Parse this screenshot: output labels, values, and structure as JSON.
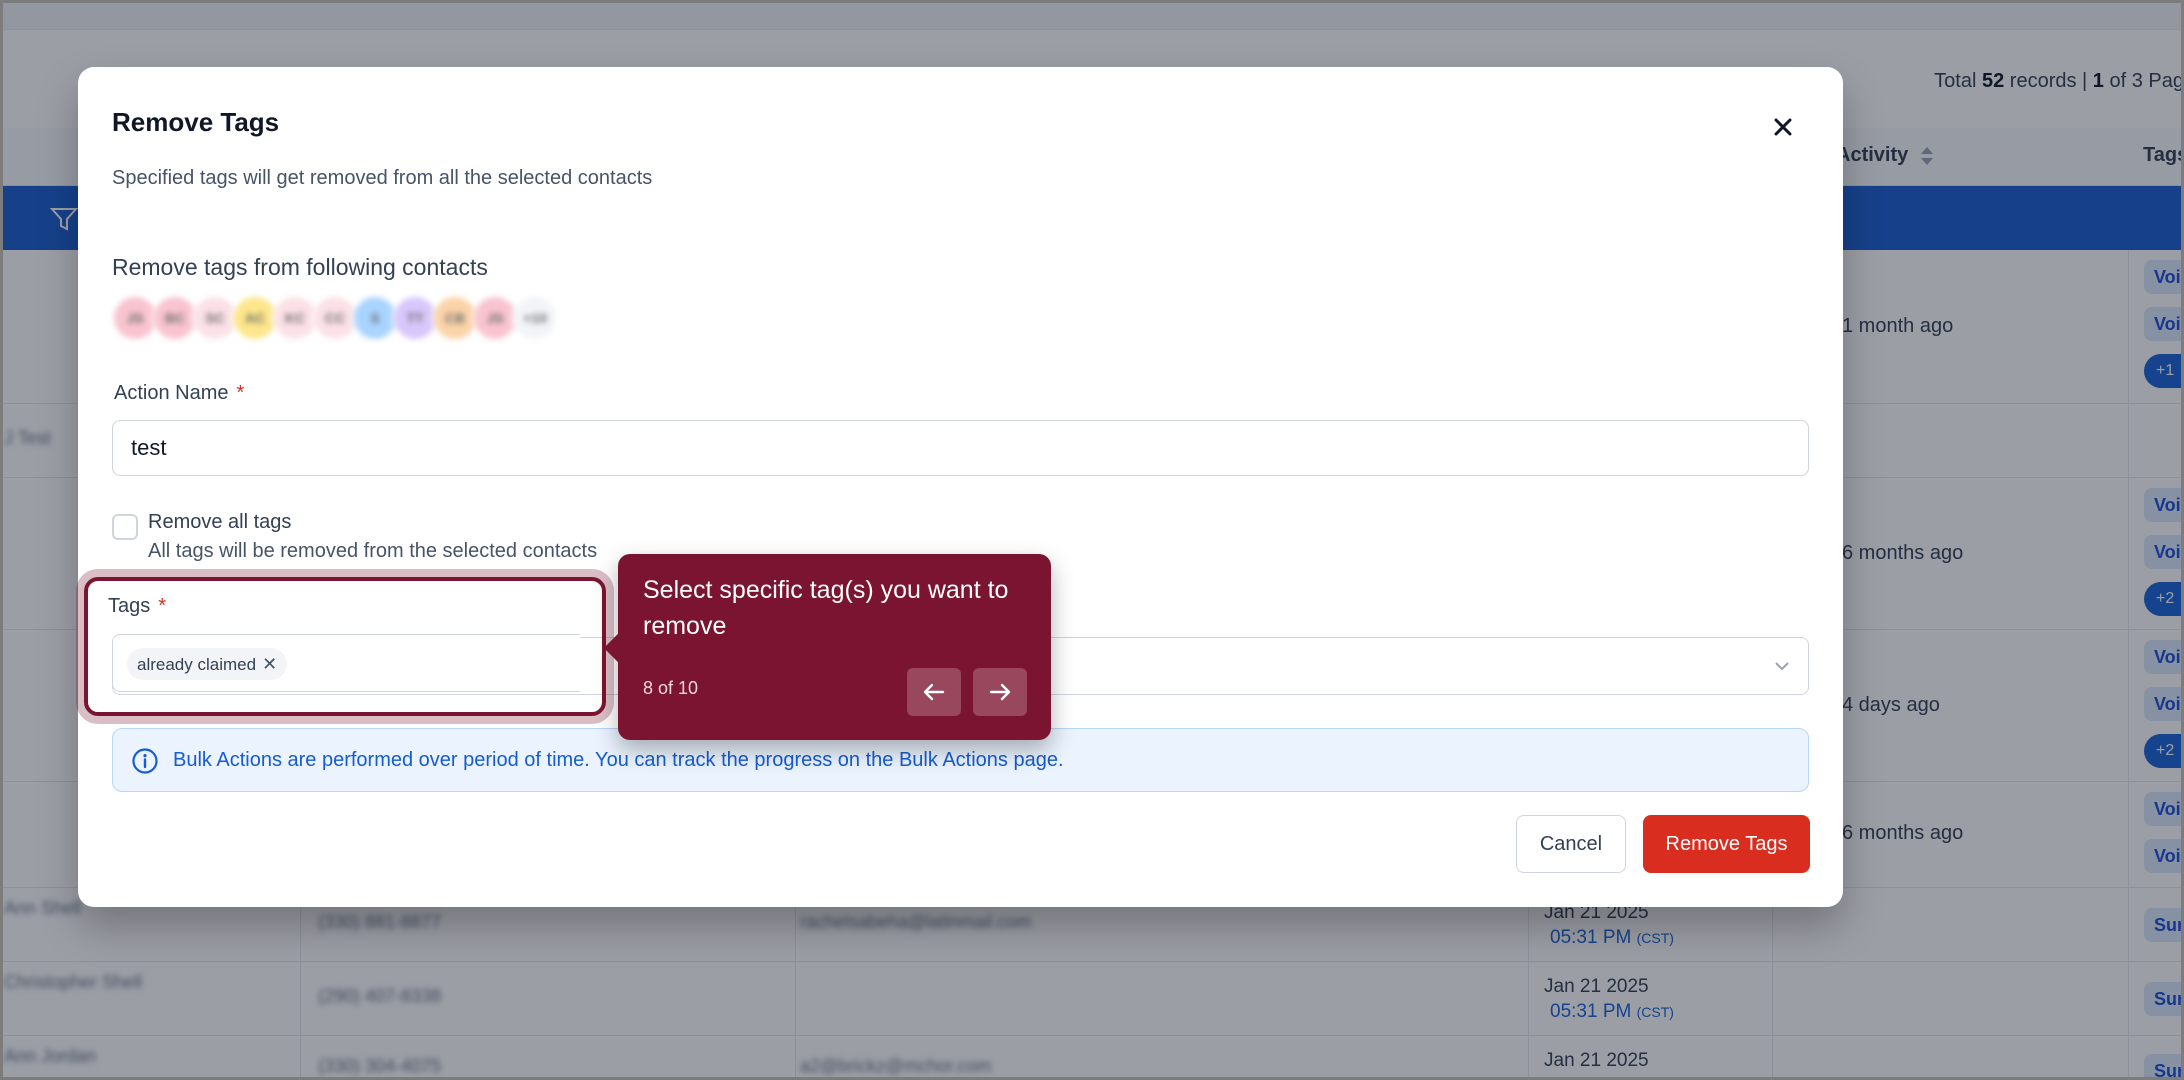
{
  "background": {
    "records": {
      "prefix": "Total",
      "count": "52",
      "mid": "records |",
      "page": "1",
      "suffix": "of 3 Pag"
    },
    "columns": {
      "activity": "Activity",
      "tags": "Tags"
    },
    "rows": [
      {
        "activity": "1 month ago",
        "tags": [
          "Voi",
          "Voi"
        ],
        "more": "+1"
      },
      {
        "activity": "",
        "tags": [],
        "more": ""
      },
      {
        "activity": "6 months ago",
        "tags": [
          "Voi",
          "Voi"
        ],
        "more": "+2"
      },
      {
        "activity": "4 days ago",
        "tags": [
          "Voi",
          "Voi"
        ],
        "more": "+2"
      },
      {
        "activity": "6 months ago",
        "tags": [
          "Voi",
          "Voi"
        ],
        "more": ""
      }
    ],
    "lower_rows": [
      {
        "date": "Jan 21 2025",
        "time": "05:31 PM",
        "tz": "(CST)",
        "tag": "Sur"
      },
      {
        "date": "Jan 21 2025",
        "time": "05:31 PM",
        "tz": "(CST)",
        "tag": "Sur"
      },
      {
        "date": "Jan 21 2025",
        "tag": "Sur"
      }
    ]
  },
  "modal": {
    "title": "Remove Tags",
    "subtitle": "Specified tags will get removed from all the selected contacts",
    "contacts_heading": "Remove tags from following contacts",
    "avatars": [
      {
        "initials": "JS",
        "color": "#f9c4cf"
      },
      {
        "initials": "BC",
        "color": "#f9c4cf"
      },
      {
        "initials": "SC",
        "color": "#fbe1e6"
      },
      {
        "initials": "AC",
        "color": "#fde68a"
      },
      {
        "initials": "KC",
        "color": "#fbe1e6"
      },
      {
        "initials": "CC",
        "color": "#fbe1e6"
      },
      {
        "initials": "S",
        "color": "#a9d4ff"
      },
      {
        "initials": "TT",
        "color": "#d7c7fb"
      },
      {
        "initials": "CB",
        "color": "#fbd3a8"
      },
      {
        "initials": "JS",
        "color": "#f9c4cf"
      },
      {
        "initials": "+10",
        "color": "#f2f4f7"
      }
    ],
    "action_name_label": "Action Name",
    "action_name_value": "test",
    "remove_all_label": "Remove all tags",
    "remove_all_desc": "All tags will be removed from the selected contacts",
    "tags_label": "Tags",
    "selected_tag": "already claimed",
    "info_text": "Bulk Actions are performed over period of time. You can track the progress on the Bulk Actions page.",
    "cancel_label": "Cancel",
    "submit_label": "Remove Tags"
  },
  "tour": {
    "text": "Select specific tag(s) you want to remove",
    "step": "8 of 10"
  },
  "colors": {
    "tour_accent": "#7b1430",
    "primary_blue": "#1b5fd1",
    "danger": "#d92d20",
    "info_text": "#175cd3"
  }
}
